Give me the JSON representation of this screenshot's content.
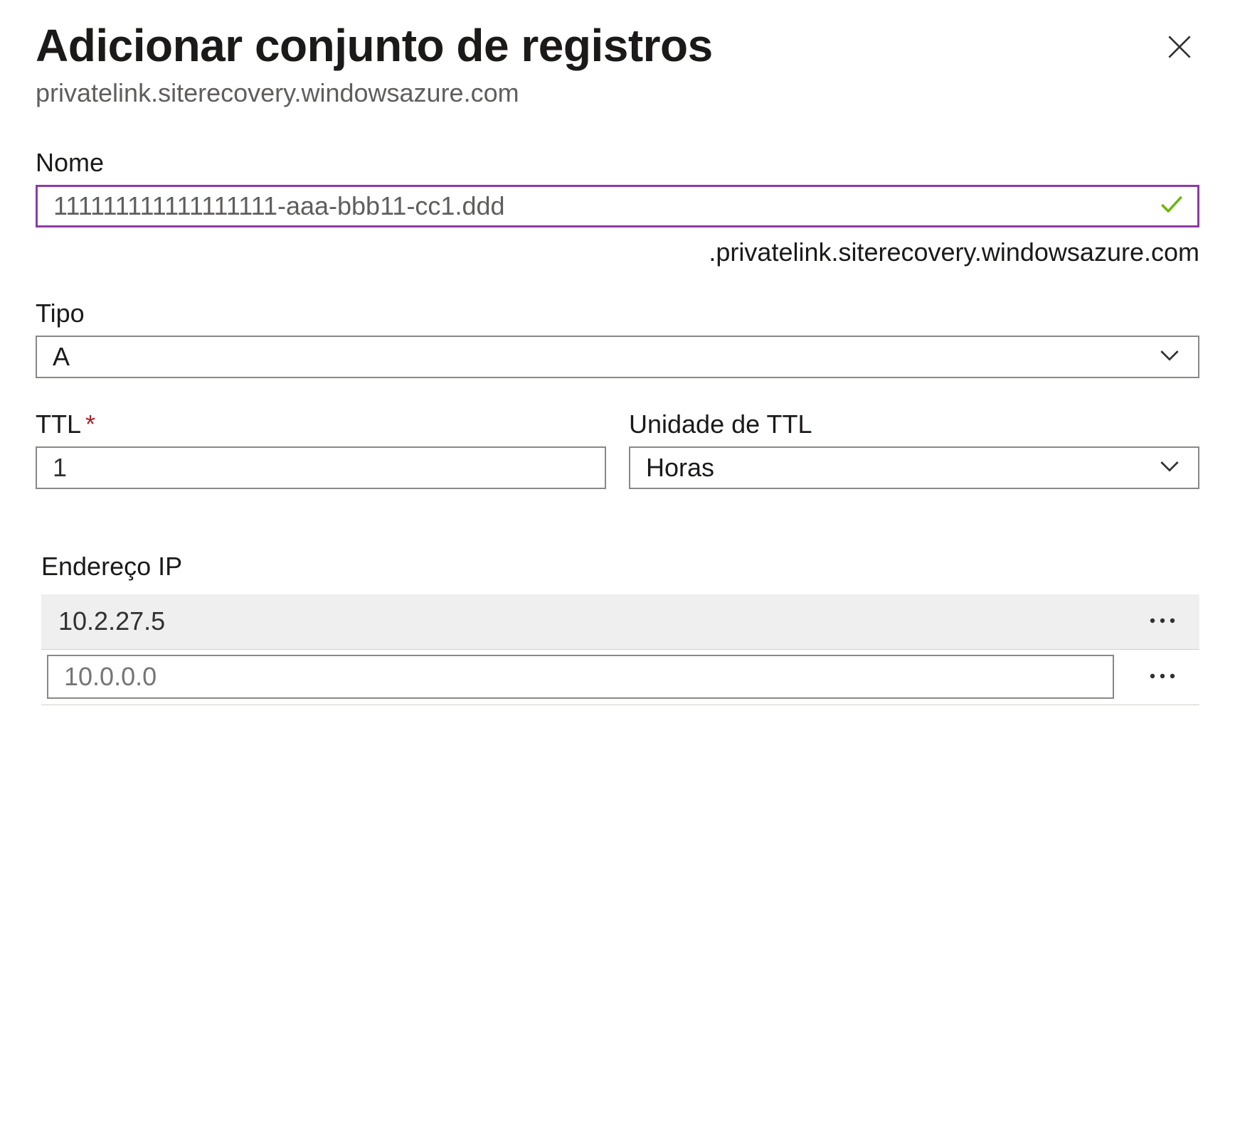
{
  "header": {
    "title": "Adicionar conjunto de registros",
    "subtitle": "privatelink.siterecovery.windowsazure.com"
  },
  "name": {
    "label": "Nome",
    "value": "111111111111111111-aaa-bbb11-cc1.ddd",
    "suffix": ".privatelink.siterecovery.windowsazure.com"
  },
  "type": {
    "label": "Tipo",
    "value": "A"
  },
  "ttl": {
    "label": "TTL",
    "required": "*",
    "value": "1"
  },
  "ttl_unit": {
    "label": "Unidade de TTL",
    "value": "Horas"
  },
  "ip": {
    "label": "Endereço IP",
    "rows": [
      "10.2.27.5"
    ],
    "placeholder": "10.0.0.0"
  }
}
